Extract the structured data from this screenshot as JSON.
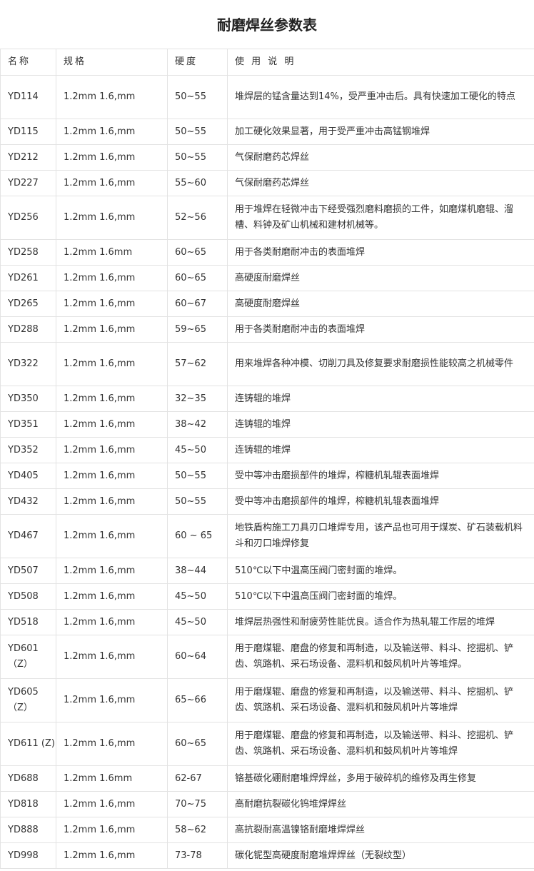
{
  "title": "耐磨焊丝参数表",
  "headers": [
    "名称",
    "规格",
    "硬度",
    "使 用 说 明"
  ],
  "rows": [
    {
      "name": "YD114",
      "spec": "1.2mm 1.6,mm",
      "hardness": "50~55",
      "desc": "堆焊层的锰含量达到14%，受严重冲击后。具有快速加工硬化的特点",
      "tall": true
    },
    {
      "name": "YD115",
      "spec": "1.2mm 1.6,mm",
      "hardness": "50~55",
      "desc": "加工硬化效果显著，用于受严重冲击高锰钢堆焊"
    },
    {
      "name": "YD212",
      "spec": "1.2mm 1.6,mm",
      "hardness": "50~55",
      "desc": "气保耐磨药芯焊丝"
    },
    {
      "name": "YD227",
      "spec": "1.2mm 1.6,mm",
      "hardness": "55~60",
      "desc": "气保耐磨药芯焊丝"
    },
    {
      "name": "YD256",
      "spec": "1.2mm 1.6,mm",
      "hardness": "52~56",
      "desc": "用于堆焊在轻微冲击下经受强烈磨料磨损的工件，如磨煤机磨辊、溜槽、料钟及矿山机械和建材机械等。",
      "tall": true
    },
    {
      "name": "YD258",
      "spec": "1.2mm 1.6mm",
      "hardness": "60~65",
      "desc": "用于各类耐磨耐冲击的表面堆焊"
    },
    {
      "name": "YD261",
      "spec": "1.2mm 1.6,mm",
      "hardness": "60~65",
      "desc": "高硬度耐磨焊丝"
    },
    {
      "name": "YD265",
      "spec": "1.2mm 1.6,mm",
      "hardness": "60~67",
      "desc": "高硬度耐磨焊丝"
    },
    {
      "name": "YD288",
      "spec": "1.2mm 1.6,mm",
      "hardness": "59~65",
      "desc": "用于各类耐磨耐冲击的表面堆焊"
    },
    {
      "name": "YD322",
      "spec": "1.2mm 1.6,mm",
      "hardness": "57~62",
      "desc": "用来堆焊各种冲模、切削刀具及修复要求耐磨损性能较高之机械零件",
      "tall": true
    },
    {
      "name": "YD350",
      "spec": "1.2mm 1.6,mm",
      "hardness": "32~35",
      "desc": "连铸辊的堆焊"
    },
    {
      "name": "YD351",
      "spec": "1.2mm 1.6,mm",
      "hardness": "38~42",
      "desc": "连铸辊的堆焊"
    },
    {
      "name": "YD352",
      "spec": "1.2mm 1.6,mm",
      "hardness": "45~50",
      "desc": "连铸辊的堆焊"
    },
    {
      "name": "YD405",
      "spec": "1.2mm 1.6,mm",
      "hardness": "50~55",
      "desc": "受中等冲击磨损部件的堆焊，榨糖机轧辊表面堆焊"
    },
    {
      "name": "YD432",
      "spec": "1.2mm 1.6,mm",
      "hardness": "50~55",
      "desc": "受中等冲击磨损部件的堆焊，榨糖机轧辊表面堆焊"
    },
    {
      "name": "YD467",
      "spec": "1.2mm 1.6,mm",
      "hardness": "60 ~ 65",
      "desc": "地铁盾构施工刀具刃口堆焊专用，该产品也可用于煤炭、矿石装载机料斗和刃口堆焊修复",
      "tall": true
    },
    {
      "name": "YD507",
      "spec": "1.2mm 1.6,mm",
      "hardness": "38~44",
      "desc": "510℃以下中温高压阀门密封面的堆焊。"
    },
    {
      "name": "YD508",
      "spec": "1.2mm 1.6,mm",
      "hardness": "45~50",
      "desc": "510℃以下中温高压阀门密封面的堆焊。"
    },
    {
      "name": "YD518",
      "spec": "1.2mm 1.6,mm",
      "hardness": "45~50",
      "desc": "堆焊层热强性和耐疲劳性能优良。适合作为热轧辊工作层的堆焊"
    },
    {
      "name": "YD601（Z）",
      "spec": "1.2mm 1.6,mm",
      "hardness": "60~64",
      "desc": "用于磨煤辊、磨盘的修复和再制造，以及输送带、料斗、挖掘机、铲齿、筑路机、采石场设备、混料机和鼓风机叶片等堆焊。",
      "tall": true
    },
    {
      "name": "YD605（Z）",
      "spec": "1.2mm 1.6,mm",
      "hardness": "65~66",
      "desc": "用于磨煤辊、磨盘的修复和再制造，以及输送带、料斗、挖掘机、铲齿、筑路机、采石场设备、混料机和鼓风机叶片等堆焊",
      "tall": true
    },
    {
      "name": "YD611 (Z)",
      "spec": "1.2mm 1.6,mm",
      "hardness": "60~65",
      "desc": "用于磨煤辊、磨盘的修复和再制造，以及输送带、料斗、挖掘机、铲齿、筑路机、采石场设备、混料机和鼓风机叶片等堆焊",
      "tall": true
    },
    {
      "name": "YD688",
      "spec": "1.2mm 1.6mm",
      "hardness": "62-67",
      "desc": "铬基碳化硼耐磨堆焊焊丝，多用于破碎机的维修及再生修复"
    },
    {
      "name": "YD818",
      "spec": "1.2mm 1.6,mm",
      "hardness": "70~75",
      "desc": "高耐磨抗裂碳化钨堆焊焊丝"
    },
    {
      "name": "YD888",
      "spec": "1.2mm 1.6,mm",
      "hardness": "58~62",
      "desc": "高抗裂耐高温镍铬耐磨堆焊焊丝"
    },
    {
      "name": "YD998",
      "spec": "1.2mm 1.6,mm",
      "hardness": "73-78",
      "desc": "碳化铌型高硬度耐磨堆焊焊丝（无裂纹型）"
    }
  ]
}
